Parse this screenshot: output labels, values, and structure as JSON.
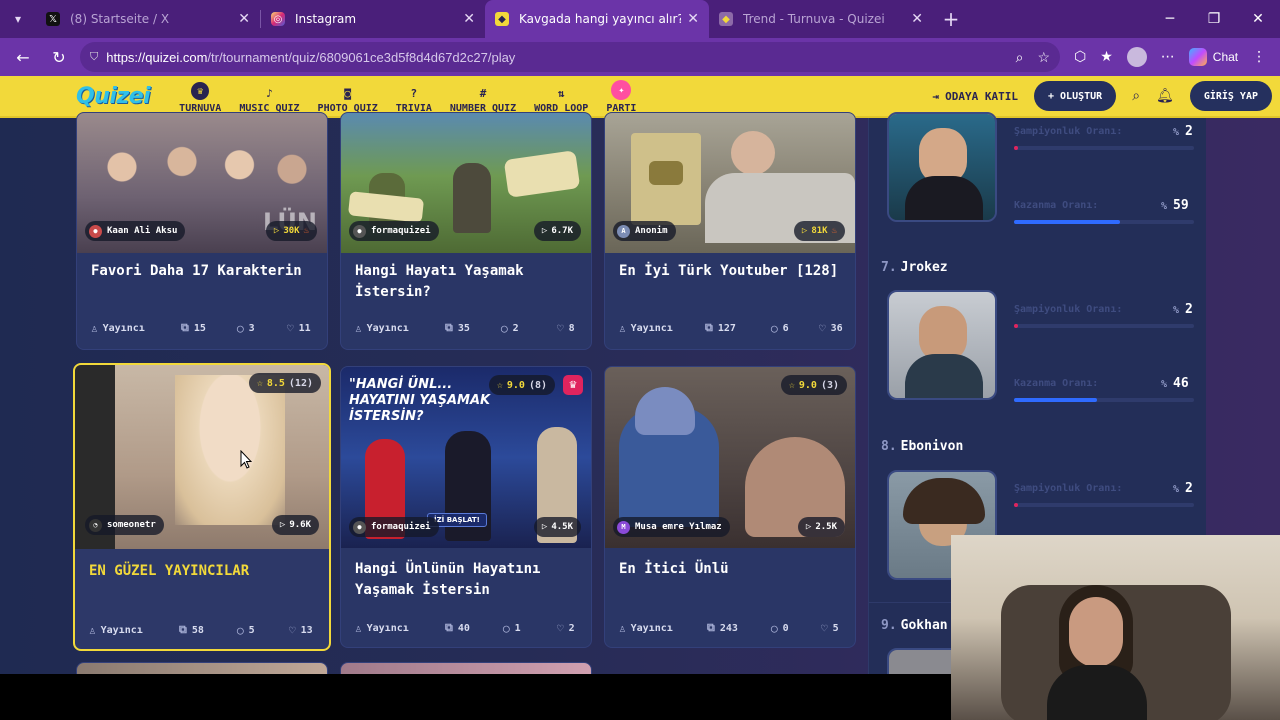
{
  "browser": {
    "tabs": [
      {
        "title": "(8) Startseite / X",
        "icon": "x-logo-icon",
        "active": false
      },
      {
        "title": "Instagram",
        "icon": "instagram-icon",
        "active": false
      },
      {
        "title": "Kavgada hangi yayıncı alır? (Yeni)",
        "icon": "quizei-favicon-icon",
        "active": true
      },
      {
        "title": "Trend - Turnuva - Quizei",
        "icon": "quizei-favicon-icon",
        "active": false
      }
    ],
    "url_host": "https://quizei.com",
    "url_path": "/tr/tournament/quiz/6809061ce3d5f8d4d67d2c27/play",
    "chat_label": "Chat"
  },
  "site": {
    "logo": "Quizei",
    "menu": [
      {
        "label": "TURNUVA",
        "icon": "trophy-icon"
      },
      {
        "label": "MUSIC QUIZ",
        "icon": "music-note-icon"
      },
      {
        "label": "PHOTO QUIZ",
        "icon": "camera-icon"
      },
      {
        "label": "TRIVIA",
        "icon": "question-icon"
      },
      {
        "label": "NUMBER QUIZ",
        "icon": "hash-icon"
      },
      {
        "label": "WORD LOOP",
        "icon": "arrows-icon"
      },
      {
        "label": "PARTI",
        "icon": "party-icon"
      }
    ],
    "join_label": "ODAYA KATIL",
    "create_label": "+ OLUŞTUR",
    "login_label": "GİRİŞ YAP"
  },
  "cards": [
    {
      "author": "Kaan Ali Aksu",
      "plays": "30K",
      "hot": true,
      "title": "Favori Daha 17 Karakterin",
      "role": "Yayıncı",
      "questions": "15",
      "comments": "3",
      "likes": "11",
      "thumb_color": "#7a6a7e"
    },
    {
      "author": "formaquizei",
      "plays": "6.7K",
      "hot": false,
      "title": "Hangi Hayatı Yaşamak İstersin?",
      "role": "Yayıncı",
      "questions": "35",
      "comments": "2",
      "likes": "8",
      "thumb_color": "#4f6e3a"
    },
    {
      "author": "Anonim",
      "plays": "81K",
      "hot": true,
      "title": "En İyi Türk Youtuber [128]",
      "role": "Yayıncı",
      "questions": "127",
      "comments": "6",
      "likes": "36",
      "thumb_color": "#8a8576"
    },
    {
      "author": "someonetr",
      "plays": "9.6K",
      "rating": "8.5",
      "rating_count": "(12)",
      "title": "EN GÜZEL YAYINCILAR",
      "role": "Yayıncı",
      "questions": "58",
      "comments": "5",
      "likes": "13",
      "thumb_color": "#b39b86"
    },
    {
      "author": "formaquizei",
      "plays": "4.5K",
      "rating": "9.0",
      "rating_count": "(8)",
      "title": "Hangi Ünlünün Hayatını Yaşamak İstersin",
      "role": "Yayıncı",
      "questions": "40",
      "comments": "1",
      "likes": "2",
      "thumb_color": "#2b3c78",
      "thumb_text": "\"HANGİ ÜNL... HAYATINI YAŞAMAK İSTERSİN?",
      "thumb_badge": "İZİ BAŞLAT!"
    },
    {
      "author": "Musa emre Yılmaz",
      "plays": "2.5K",
      "rating": "9.0",
      "rating_count": "(3)",
      "title": "En İtici Ünlü",
      "role": "Yayıncı",
      "questions": "243",
      "comments": "0",
      "likes": "5",
      "thumb_color": "#5a4a48"
    }
  ],
  "sidebar": {
    "champ_label": "Şampiyonluk Oranı:",
    "win_label": "Kazanma Oranı:",
    "players": [
      {
        "rank": "",
        "name": "",
        "champ": "2",
        "win": "59",
        "champ_frac": 0.02,
        "win_frac": 0.59
      },
      {
        "rank": "7.",
        "name": "Jrokez",
        "champ": "2",
        "win": "46",
        "champ_frac": 0.02,
        "win_frac": 0.46
      },
      {
        "rank": "8.",
        "name": "Ebonivon",
        "champ": "2",
        "champ_frac": 0.02
      },
      {
        "rank": "9.",
        "name": "Gokhan"
      }
    ]
  }
}
